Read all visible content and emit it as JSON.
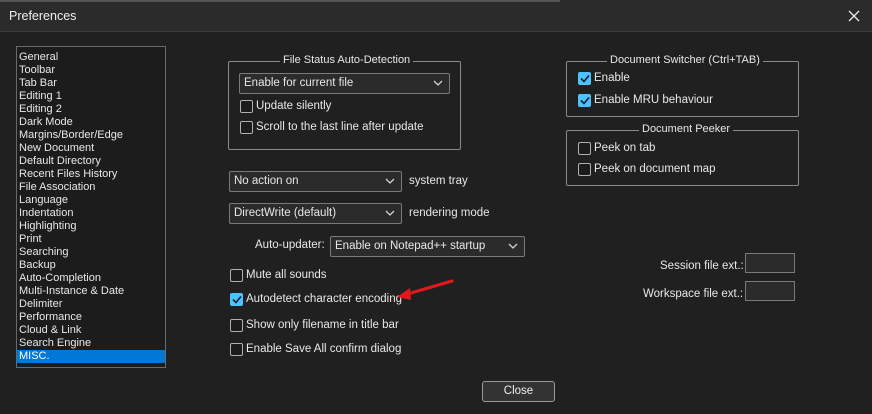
{
  "window": {
    "title": "Preferences"
  },
  "categories": [
    "General",
    "Toolbar",
    "Tab Bar",
    "Editing 1",
    "Editing 2",
    "Dark Mode",
    "Margins/Border/Edge",
    "New Document",
    "Default Directory",
    "Recent Files History",
    "File Association",
    "Language",
    "Indentation",
    "Highlighting",
    "Print",
    "Searching",
    "Backup",
    "Auto-Completion",
    "Multi-Instance & Date",
    "Delimiter",
    "Performance",
    "Cloud & Link",
    "Search Engine",
    "MISC."
  ],
  "selected_category": "MISC.",
  "file_status": {
    "group_label": "File Status Auto-Detection",
    "dropdown_value": "Enable for current file",
    "update_silently": {
      "label": "Update silently",
      "checked": false
    },
    "scroll_last_line": {
      "label": "Scroll to the last line after update",
      "checked": false
    }
  },
  "document_switcher": {
    "group_label": "Document Switcher (Ctrl+TAB)",
    "enable": {
      "label": "Enable",
      "checked": true
    },
    "enable_mru": {
      "label": "Enable MRU behaviour",
      "checked": true
    }
  },
  "document_peeker": {
    "group_label": "Document Peeker",
    "peek_on_tab": {
      "label": "Peek on tab",
      "checked": false
    },
    "peek_on_map": {
      "label": "Peek on document map",
      "checked": false
    }
  },
  "system_tray": {
    "value": "No action on",
    "label": "system tray"
  },
  "rendering": {
    "value": "DirectWrite (default)",
    "label": "rendering mode"
  },
  "auto_updater": {
    "label": "Auto-updater:",
    "value": "Enable on Notepad++ startup"
  },
  "options": {
    "mute_sounds": {
      "label": "Mute all sounds",
      "checked": false
    },
    "autodetect_encoding": {
      "label": "Autodetect character encoding",
      "checked": true
    },
    "filename_title": {
      "label": "Show only filename in title bar",
      "checked": false
    },
    "save_all_confirm": {
      "label": "Enable Save All confirm dialog",
      "checked": false
    }
  },
  "session_ext": {
    "label": "Session file ext.:",
    "value": ""
  },
  "workspace_ext": {
    "label": "Workspace file ext.:",
    "value": ""
  },
  "buttons": {
    "close": "Close"
  },
  "colors": {
    "accent": "#0078d7",
    "checkbox_on": "#4cc2ff",
    "arrow": "#e0191d"
  }
}
